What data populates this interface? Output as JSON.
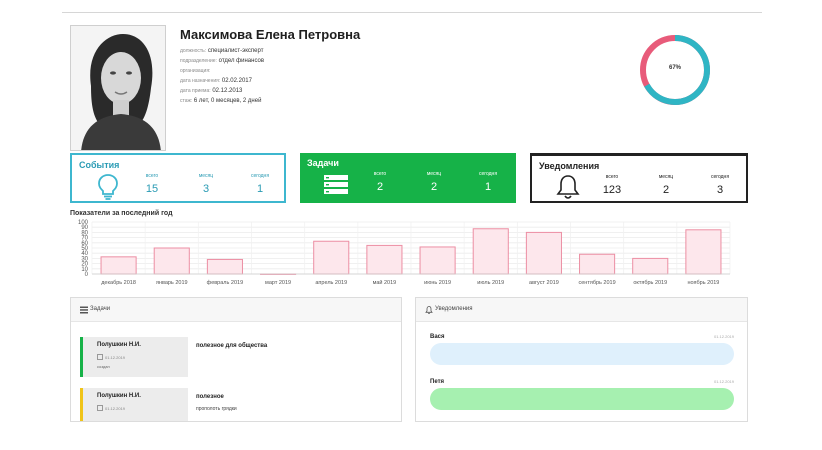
{
  "profile": {
    "name": "Максимова Елена Петровна",
    "fields": [
      {
        "label": "должность:",
        "value": "специалист-эксперт"
      },
      {
        "label": "подразделение:",
        "value": "отдел финансов"
      },
      {
        "label": "организация:",
        "value": ""
      },
      {
        "label": "дата назначения:",
        "value": "02.02.2017"
      },
      {
        "label": "дата приема:",
        "value": "02.12.2013"
      },
      {
        "label": "стаж:",
        "value": "6 лет, 0 месяцев, 2 дней"
      }
    ],
    "progress": {
      "value": 0.67,
      "label": "67%",
      "fill_color": "#2fb5c4",
      "rest_color": "#e85b7a"
    }
  },
  "cards": {
    "events": {
      "title": "События",
      "icon": "lightbulb-icon",
      "color": "#3eb7cf",
      "stats": [
        {
          "label": "всего",
          "value": "15"
        },
        {
          "label": "месяц",
          "value": "3"
        },
        {
          "label": "сегодня",
          "value": "1"
        }
      ]
    },
    "tasks": {
      "title": "Задачи",
      "icon": "server-list-icon",
      "color": "#16b248",
      "stats": [
        {
          "label": "всего",
          "value": "2"
        },
        {
          "label": "месяц",
          "value": "2"
        },
        {
          "label": "сегодня",
          "value": "1"
        }
      ]
    },
    "notifications": {
      "title": "Уведомления",
      "icon": "bell-icon",
      "color": "#222222",
      "stats": [
        {
          "label": "всего",
          "value": "123"
        },
        {
          "label": "месяц",
          "value": "2"
        },
        {
          "label": "сегодня",
          "value": "3"
        }
      ]
    }
  },
  "chart_title": "Показатели за последний год",
  "chart_data": {
    "type": "bar",
    "categories": [
      "декабрь 2018",
      "январь 2019",
      "февраль 2019",
      "март 2019",
      "апрель 2019",
      "май 2019",
      "июнь 2019",
      "июль 2019",
      "август 2019",
      "сентябрь 2019",
      "октябрь 2019",
      "ноябрь 2019"
    ],
    "values": [
      33,
      50,
      28,
      0,
      63,
      55,
      52,
      87,
      80,
      38,
      30,
      85
    ],
    "ylim": [
      0,
      100
    ],
    "yticks": [
      0,
      10,
      20,
      30,
      40,
      50,
      60,
      70,
      80,
      90,
      100
    ],
    "grid": true,
    "bar_fill": "#fde7ec",
    "bar_stroke": "#ec8ea3",
    "title": "",
    "xlabel": "",
    "ylabel": ""
  },
  "tasks_panel": {
    "title": "Задачи",
    "icon": "list-icon",
    "items": [
      {
        "assignee": "Полушкин Н.И.",
        "date": "01.12.2019",
        "status": "создан",
        "name": "полезное для общества",
        "description": "",
        "color": "#16b248"
      },
      {
        "assignee": "Полушкин Н.И.",
        "date": "01.12.2019",
        "status": "",
        "name": "полезное",
        "description": "прополоть грядки",
        "color": "#f0c419"
      }
    ]
  },
  "notifications_panel": {
    "title": "Уведомления",
    "icon": "bell-icon",
    "items": [
      {
        "from": "Вася",
        "date": "01.12.2019",
        "text": "",
        "color": "#dff0fc"
      },
      {
        "from": "Петя",
        "date": "01.12.2019",
        "text": "",
        "color": "#a6f0b0"
      }
    ]
  }
}
